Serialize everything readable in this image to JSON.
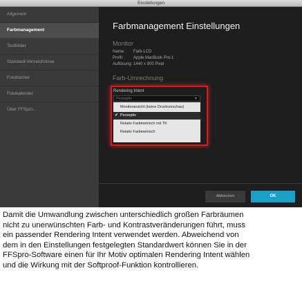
{
  "window": {
    "title": "Einstellungen"
  },
  "sidebar": {
    "items": [
      {
        "label": "Allgemein"
      },
      {
        "label": "Farbmanagement"
      },
      {
        "label": "Testbilder"
      },
      {
        "label": "Standard-Verzeichnisse"
      },
      {
        "label": "Fotobücher"
      },
      {
        "label": "Fotokalender"
      },
      {
        "label": "Über FFSpro..."
      }
    ]
  },
  "main": {
    "title": "Farbmanagement Einstellungen",
    "monitor_section": "Monitor",
    "monitor": [
      {
        "key": "Name:",
        "value": "Farb-LCD"
      },
      {
        "key": "Profil:",
        "value": "Apple MacBook Pro-1"
      },
      {
        "key": "Auflösung:",
        "value": "1440 x 900 Pixel"
      }
    ],
    "conversion_section": "Farb-Umrechnung",
    "rendering_intent": {
      "label": "Rendering Intent",
      "selected": "Perzeptiv",
      "options": [
        "Monitoransicht (keine Druckvorschau)",
        "Perzeptiv",
        "Relativ Farbmetrisch mit TK",
        "Relativ Farbmetrisch"
      ]
    }
  },
  "footer": {
    "cancel_label": "Abbrechen",
    "ok_label": "OK"
  },
  "caption": {
    "lines": [
      "Damit die Umwandlung zwischen unterschiedlich großen Farbräumen",
      "nicht zu unerwünschten Farb- und Kontrastveränderungen führt, muss",
      "ein passender Rendering Intent verwendet werden. Abweichend von",
      "dem in den Einstellungen festgelegten Standardwert können Sie in der",
      "FFSpro-Software einen für Ihr Motiv optimalen Rendering Intent wählen",
      "und die Wirkung mit der Softproof-Funktion kontrollieren."
    ]
  },
  "colors": {
    "accent": "#1aa0c8",
    "highlight_border": "#e01818",
    "sidebar_bg": "#3a3a3a",
    "panel_bg": "#1e1e1e"
  }
}
